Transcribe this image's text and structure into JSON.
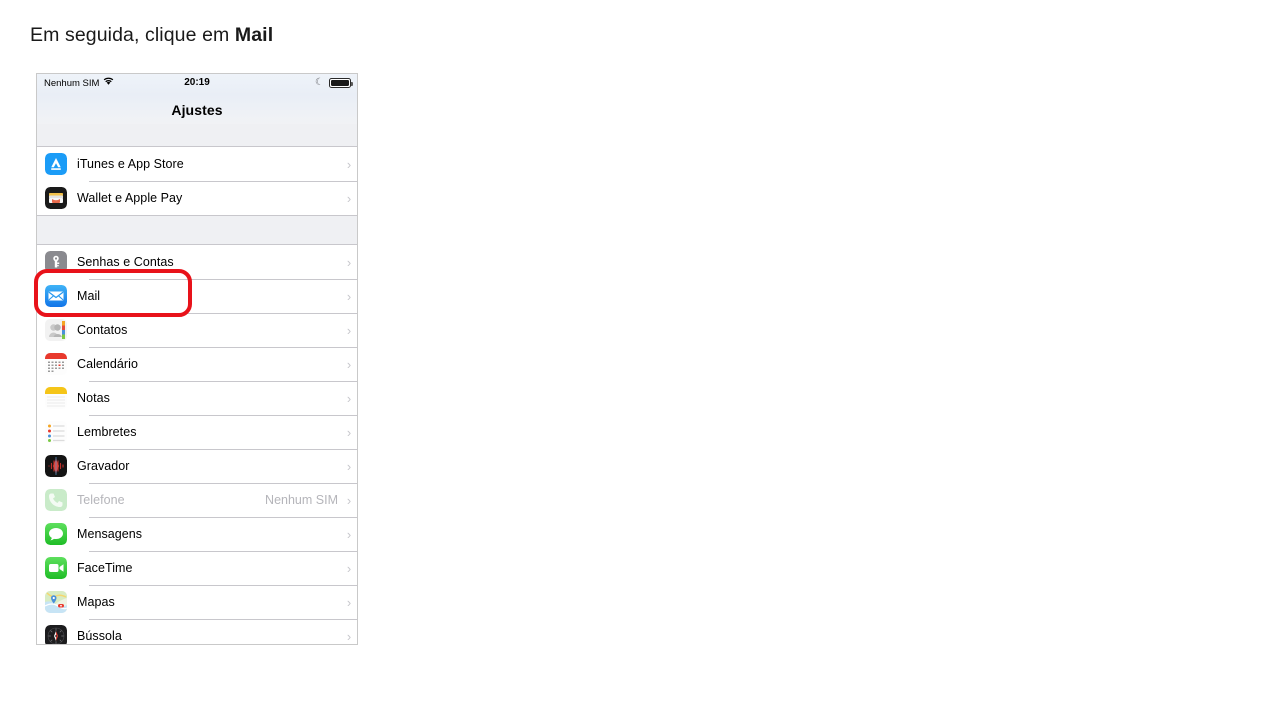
{
  "caption": {
    "text_before": "Em seguida, clique em ",
    "bold_word": "Mail"
  },
  "screenshot": {
    "status_bar": {
      "carrier": "Nenhum SIM",
      "wifi_icon": "wifi-icon",
      "time": "20:19",
      "dnd_icon": "moon-icon",
      "battery_icon": "battery-full-icon"
    },
    "nav_title": "Ajustes",
    "groups": [
      {
        "rows": [
          {
            "icon": "app-store-icon",
            "label": "iTunes e App Store",
            "value": "",
            "disabled": false,
            "chevron": "›"
          },
          {
            "icon": "wallet-icon",
            "label": "Wallet e Apple Pay",
            "value": "",
            "disabled": false,
            "chevron": "›"
          }
        ]
      },
      {
        "rows": [
          {
            "icon": "passwords-icon",
            "label": "Senhas e Contas",
            "value": "",
            "disabled": false,
            "chevron": "›"
          },
          {
            "icon": "mail-icon",
            "label": "Mail",
            "value": "",
            "disabled": false,
            "chevron": "›"
          },
          {
            "icon": "contacts-icon",
            "label": "Contatos",
            "value": "",
            "disabled": false,
            "chevron": "›"
          },
          {
            "icon": "calendar-icon",
            "label": "Calendário",
            "value": "",
            "disabled": false,
            "chevron": "›"
          },
          {
            "icon": "notes-icon",
            "label": "Notas",
            "value": "",
            "disabled": false,
            "chevron": "›"
          },
          {
            "icon": "reminders-icon",
            "label": "Lembretes",
            "value": "",
            "disabled": false,
            "chevron": "›"
          },
          {
            "icon": "voice-memos-icon",
            "label": "Gravador",
            "value": "",
            "disabled": false,
            "chevron": "›"
          },
          {
            "icon": "phone-icon",
            "label": "Telefone",
            "value": "Nenhum SIM",
            "disabled": true,
            "chevron": "›"
          },
          {
            "icon": "messages-icon",
            "label": "Mensagens",
            "value": "",
            "disabled": false,
            "chevron": "›"
          },
          {
            "icon": "facetime-icon",
            "label": "FaceTime",
            "value": "",
            "disabled": false,
            "chevron": "›"
          },
          {
            "icon": "maps-icon",
            "label": "Mapas",
            "value": "",
            "disabled": false,
            "chevron": "›"
          },
          {
            "icon": "compass-icon",
            "label": "Bússola",
            "value": "",
            "disabled": false,
            "chevron": "›"
          }
        ]
      }
    ]
  },
  "annotation": {
    "highlight_color": "#e8121a",
    "highlight_target": "Mail"
  }
}
